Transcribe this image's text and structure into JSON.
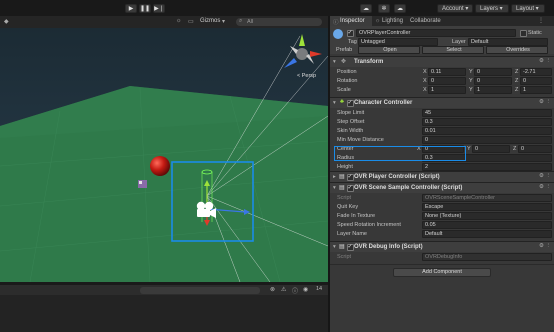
{
  "toolbar": {
    "account": "Account",
    "layers": "Layers",
    "layout": "Layout"
  },
  "scene": {
    "gizmos": "Gizmos",
    "persp": "< Persp",
    "search_placeholder": "All"
  },
  "bottom": {
    "count": "14"
  },
  "tabs": {
    "inspector": "Inspector",
    "lighting": "Lighting",
    "collaborate": "Collaborate"
  },
  "object": {
    "name": "OVRPlayerController",
    "static": "Static",
    "tag_label": "Tag",
    "tag": "Untagged",
    "layer_label": "Layer",
    "layer": "Default",
    "prefab_label": "Prefab",
    "open": "Open",
    "select": "Select",
    "overrides": "Overrides"
  },
  "transform": {
    "title": "Transform",
    "position_label": "Position",
    "rotation_label": "Rotation",
    "scale_label": "Scale",
    "position": {
      "x": "0.11",
      "y": "0",
      "z": "-2.71"
    },
    "rotation": {
      "x": "0",
      "y": "0",
      "z": "0"
    },
    "scale": {
      "x": "1",
      "y": "1",
      "z": "1"
    }
  },
  "character_controller": {
    "title": "Character Controller",
    "slope_limit_label": "Slope Limit",
    "slope_limit": "45",
    "step_offset_label": "Step Offset",
    "step_offset": "0.3",
    "skin_width_label": "Skin Width",
    "skin_width": "0.01",
    "min_move_label": "Min Move Distance",
    "min_move": "0",
    "center_label": "Center",
    "center": {
      "x": "0",
      "y": "0",
      "z": "0"
    },
    "radius_label": "Radius",
    "radius": "0.3",
    "height_label": "Height",
    "height": "2"
  },
  "components": {
    "ovr_player_controller": "OVR Player Controller (Script)",
    "ovr_scene_sample": "OVR Scene Sample Controller (Script)",
    "ovr_debug_info": "OVR Debug Info (Script)"
  },
  "scene_sample": {
    "script_label": "Script",
    "script": "OVRSceneSampleController",
    "quit_key_label": "Quit Key",
    "quit_key": "Escape",
    "fade_label": "Fade In Texture",
    "fade": "None (Texture)",
    "speed_label": "Speed Rotation Increment",
    "speed": "0.05",
    "layer_name_label": "Layer Name",
    "layer_name": "Default"
  },
  "debug_info": {
    "script_label": "Script",
    "script": "OVRDebugInfo"
  },
  "add_component": "Add Component",
  "colors": {
    "highlight": "#1a8ce8",
    "ground": "#2f7a4a",
    "sphere": "#c41a12"
  }
}
